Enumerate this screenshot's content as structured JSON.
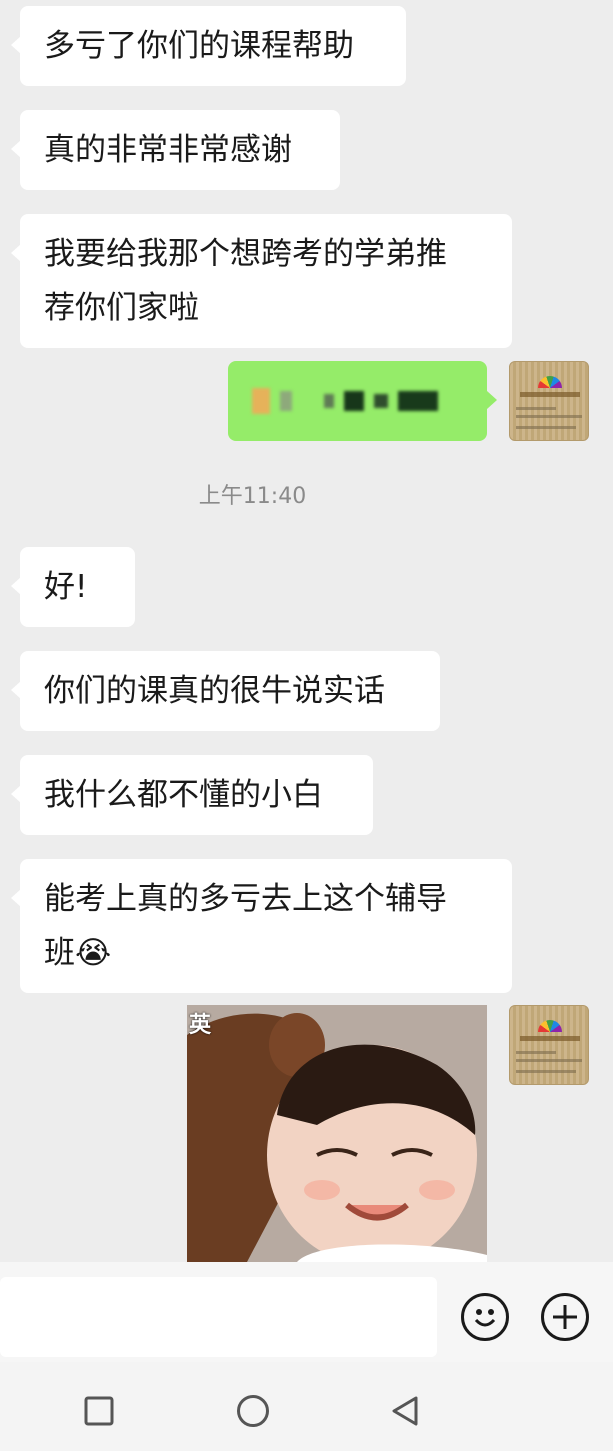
{
  "chat": {
    "messages_before": [
      {
        "from": "other",
        "lines": [
          "多亏了你们的课程帮助"
        ]
      },
      {
        "from": "other",
        "lines": [
          "真的非常非常感谢"
        ]
      },
      {
        "from": "other",
        "lines": [
          "我要给我那个想跨考的学弟推",
          "荐你们家啦"
        ]
      }
    ],
    "own_message": {
      "from": "self",
      "content": "blurred"
    },
    "timestamp": "上午11:40",
    "messages_after": [
      {
        "from": "other",
        "lines": [
          "好!"
        ]
      },
      {
        "from": "other",
        "lines": [
          "你们的课真的很牛说实话"
        ]
      },
      {
        "from": "other",
        "lines": [
          "我什么都不懂的小白"
        ]
      },
      {
        "from": "other",
        "lines": [
          "能考上真的多亏去上这个辅导",
          "班😭"
        ]
      }
    ],
    "sticker": {
      "badge": "英"
    }
  },
  "colors": {
    "background": "#ededed",
    "incoming_bubble": "#ffffff",
    "outgoing_bubble": "#95ec69",
    "timestamp_text": "#8a8a8a"
  },
  "input_bar": {
    "placeholder": "",
    "emoji_icon": "smiley-face-icon",
    "plus_icon": "plus-circle-icon"
  },
  "nav_bar": {
    "icons": [
      "recent-apps-square-icon",
      "home-circle-icon",
      "back-triangle-icon"
    ]
  }
}
